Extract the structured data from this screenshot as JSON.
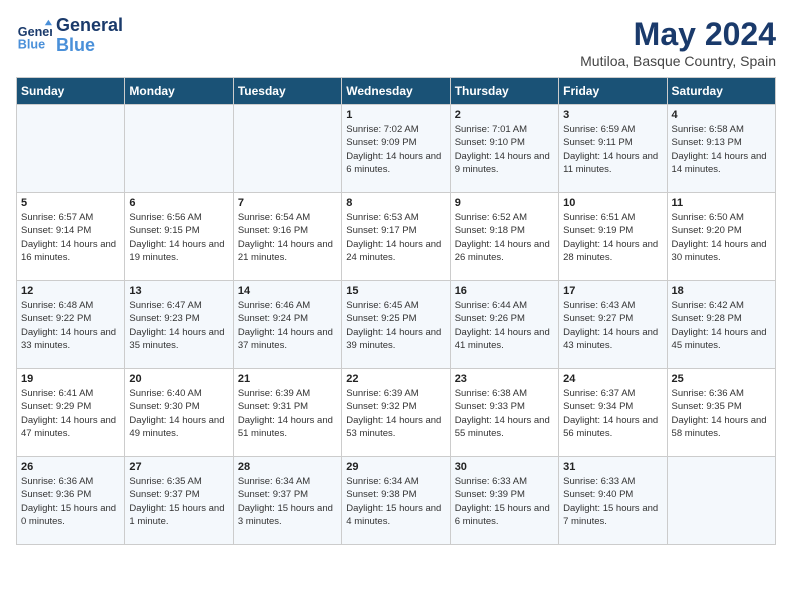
{
  "header": {
    "logo_general": "General",
    "logo_blue": "Blue",
    "title": "May 2024",
    "subtitle": "Mutiloa, Basque Country, Spain"
  },
  "weekdays": [
    "Sunday",
    "Monday",
    "Tuesday",
    "Wednesday",
    "Thursday",
    "Friday",
    "Saturday"
  ],
  "weeks": [
    [
      {
        "day": "",
        "info": ""
      },
      {
        "day": "",
        "info": ""
      },
      {
        "day": "",
        "info": ""
      },
      {
        "day": "1",
        "info": "Sunrise: 7:02 AM\nSunset: 9:09 PM\nDaylight: 14 hours\nand 6 minutes."
      },
      {
        "day": "2",
        "info": "Sunrise: 7:01 AM\nSunset: 9:10 PM\nDaylight: 14 hours\nand 9 minutes."
      },
      {
        "day": "3",
        "info": "Sunrise: 6:59 AM\nSunset: 9:11 PM\nDaylight: 14 hours\nand 11 minutes."
      },
      {
        "day": "4",
        "info": "Sunrise: 6:58 AM\nSunset: 9:13 PM\nDaylight: 14 hours\nand 14 minutes."
      }
    ],
    [
      {
        "day": "5",
        "info": "Sunrise: 6:57 AM\nSunset: 9:14 PM\nDaylight: 14 hours\nand 16 minutes."
      },
      {
        "day": "6",
        "info": "Sunrise: 6:56 AM\nSunset: 9:15 PM\nDaylight: 14 hours\nand 19 minutes."
      },
      {
        "day": "7",
        "info": "Sunrise: 6:54 AM\nSunset: 9:16 PM\nDaylight: 14 hours\nand 21 minutes."
      },
      {
        "day": "8",
        "info": "Sunrise: 6:53 AM\nSunset: 9:17 PM\nDaylight: 14 hours\nand 24 minutes."
      },
      {
        "day": "9",
        "info": "Sunrise: 6:52 AM\nSunset: 9:18 PM\nDaylight: 14 hours\nand 26 minutes."
      },
      {
        "day": "10",
        "info": "Sunrise: 6:51 AM\nSunset: 9:19 PM\nDaylight: 14 hours\nand 28 minutes."
      },
      {
        "day": "11",
        "info": "Sunrise: 6:50 AM\nSunset: 9:20 PM\nDaylight: 14 hours\nand 30 minutes."
      }
    ],
    [
      {
        "day": "12",
        "info": "Sunrise: 6:48 AM\nSunset: 9:22 PM\nDaylight: 14 hours\nand 33 minutes."
      },
      {
        "day": "13",
        "info": "Sunrise: 6:47 AM\nSunset: 9:23 PM\nDaylight: 14 hours\nand 35 minutes."
      },
      {
        "day": "14",
        "info": "Sunrise: 6:46 AM\nSunset: 9:24 PM\nDaylight: 14 hours\nand 37 minutes."
      },
      {
        "day": "15",
        "info": "Sunrise: 6:45 AM\nSunset: 9:25 PM\nDaylight: 14 hours\nand 39 minutes."
      },
      {
        "day": "16",
        "info": "Sunrise: 6:44 AM\nSunset: 9:26 PM\nDaylight: 14 hours\nand 41 minutes."
      },
      {
        "day": "17",
        "info": "Sunrise: 6:43 AM\nSunset: 9:27 PM\nDaylight: 14 hours\nand 43 minutes."
      },
      {
        "day": "18",
        "info": "Sunrise: 6:42 AM\nSunset: 9:28 PM\nDaylight: 14 hours\nand 45 minutes."
      }
    ],
    [
      {
        "day": "19",
        "info": "Sunrise: 6:41 AM\nSunset: 9:29 PM\nDaylight: 14 hours\nand 47 minutes."
      },
      {
        "day": "20",
        "info": "Sunrise: 6:40 AM\nSunset: 9:30 PM\nDaylight: 14 hours\nand 49 minutes."
      },
      {
        "day": "21",
        "info": "Sunrise: 6:39 AM\nSunset: 9:31 PM\nDaylight: 14 hours\nand 51 minutes."
      },
      {
        "day": "22",
        "info": "Sunrise: 6:39 AM\nSunset: 9:32 PM\nDaylight: 14 hours\nand 53 minutes."
      },
      {
        "day": "23",
        "info": "Sunrise: 6:38 AM\nSunset: 9:33 PM\nDaylight: 14 hours\nand 55 minutes."
      },
      {
        "day": "24",
        "info": "Sunrise: 6:37 AM\nSunset: 9:34 PM\nDaylight: 14 hours\nand 56 minutes."
      },
      {
        "day": "25",
        "info": "Sunrise: 6:36 AM\nSunset: 9:35 PM\nDaylight: 14 hours\nand 58 minutes."
      }
    ],
    [
      {
        "day": "26",
        "info": "Sunrise: 6:36 AM\nSunset: 9:36 PM\nDaylight: 15 hours\nand 0 minutes."
      },
      {
        "day": "27",
        "info": "Sunrise: 6:35 AM\nSunset: 9:37 PM\nDaylight: 15 hours\nand 1 minute."
      },
      {
        "day": "28",
        "info": "Sunrise: 6:34 AM\nSunset: 9:37 PM\nDaylight: 15 hours\nand 3 minutes."
      },
      {
        "day": "29",
        "info": "Sunrise: 6:34 AM\nSunset: 9:38 PM\nDaylight: 15 hours\nand 4 minutes."
      },
      {
        "day": "30",
        "info": "Sunrise: 6:33 AM\nSunset: 9:39 PM\nDaylight: 15 hours\nand 6 minutes."
      },
      {
        "day": "31",
        "info": "Sunrise: 6:33 AM\nSunset: 9:40 PM\nDaylight: 15 hours\nand 7 minutes."
      },
      {
        "day": "",
        "info": ""
      }
    ]
  ]
}
